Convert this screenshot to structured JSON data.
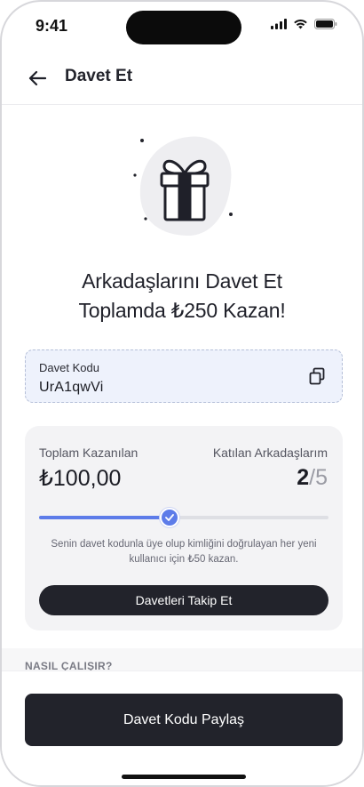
{
  "status_bar": {
    "time": "9:41"
  },
  "nav": {
    "title": "Davet Et"
  },
  "headline": {
    "line1": "Arkadaşlarını Davet Et",
    "line2": "Toplamda ₺250 Kazan!"
  },
  "invite_code": {
    "label": "Davet Kodu",
    "value": "UrA1qwVi"
  },
  "stats": {
    "earned_label": "Toplam Kazanılan",
    "earned_value": "₺100,00",
    "friends_label": "Katılan Arkadaşlarım",
    "friends_joined": "2",
    "friends_total": "/5",
    "progress_fraction": 0.45,
    "description": "Senin davet kodunla üye olup kimliğini doğrulayan her yeni kullanıcı için ₺50 kazan.",
    "track_button": "Davetleri Takip Et"
  },
  "how_it_works": {
    "label": "NASIL ÇALIŞIR?"
  },
  "share_button": {
    "label": "Davet Kodu Paylaş"
  },
  "colors": {
    "accent": "#5d7ce9",
    "dark_button": "#22232b",
    "code_bg": "#eef2fc"
  }
}
